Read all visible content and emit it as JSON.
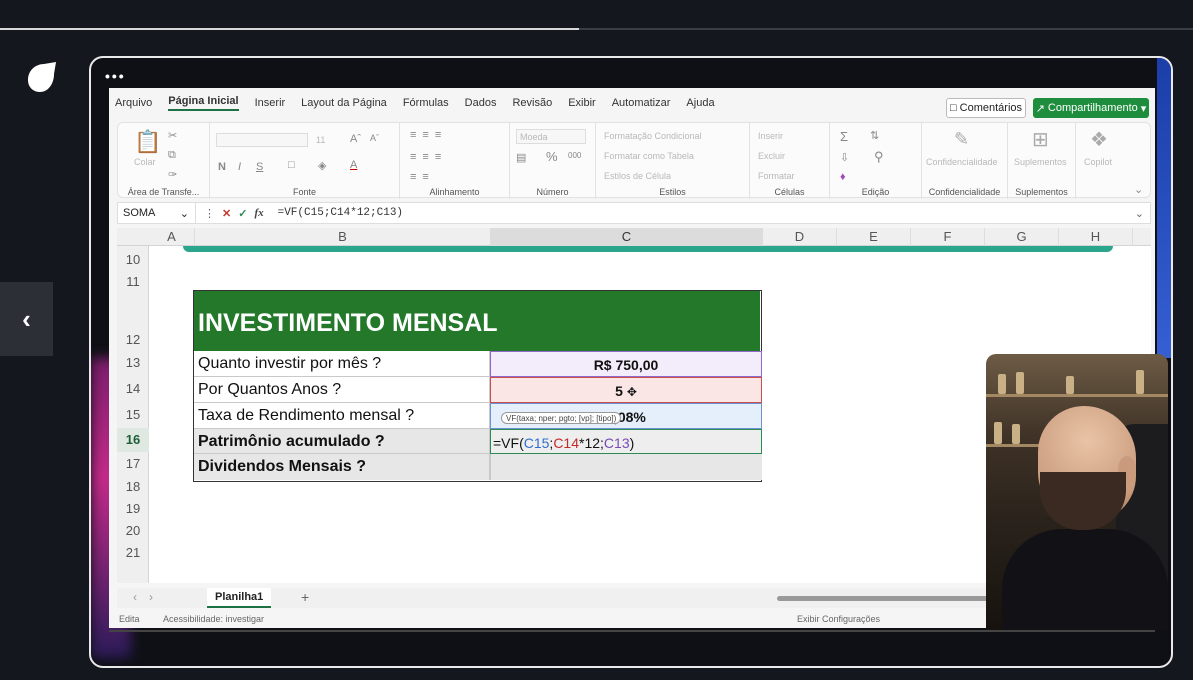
{
  "player": {
    "progress_percent": 48.5
  },
  "excel": {
    "menu": [
      "Arquivo",
      "Página Inicial",
      "Inserir",
      "Layout da Página",
      "Fórmulas",
      "Dados",
      "Revisão",
      "Exibir",
      "Automatizar",
      "Ajuda"
    ],
    "active_menu": "Página Inicial",
    "comments_label": "Comentários",
    "share_label": "Compartilhamento",
    "ribbon_groups": {
      "clipboard": "Área de Transfe...",
      "font": "Fonte",
      "alignment": "Alinhamento",
      "number": "Número",
      "styles": "Estilos",
      "cells": "Células",
      "editing": "Edição",
      "sensitivity": "Confidencialidade",
      "addins": "Suplementos"
    },
    "ribbon_items": {
      "paste": "Colar",
      "number_format": "Moeda",
      "cond_format": "Formatação Condicional",
      "format_table": "Formatar como Tabela",
      "cell_styles": "Estilos de Célula",
      "insert": "Inserir",
      "delete": "Excluir",
      "format": "Formatar",
      "sensitivity": "Confidencialidade",
      "addins": "Suplementos",
      "copilot": "Copilot",
      "font_size": "11",
      "bold": "N",
      "italic": "I",
      "underline": "S"
    },
    "name_box": "SOMA",
    "formula": "=VF(C15;C14*12;C13)",
    "columns": [
      "A",
      "B",
      "C",
      "D",
      "E",
      "F",
      "G",
      "H"
    ],
    "rows": [
      "10",
      "11",
      "12",
      "13",
      "14",
      "15",
      "16",
      "17",
      "18",
      "19",
      "20",
      "21"
    ],
    "table": {
      "title": "INVESTIMENTO MENSAL",
      "labels": [
        "Quanto investir por mês ?",
        "Por Quantos Anos ?",
        "Taxa de Rendimento mensal ?",
        "Patrimônio acumulado ?",
        "Dividendos Mensais ?"
      ],
      "values": [
        "R$ 750,00",
        "5",
        "1,08%"
      ],
      "formula_parts": {
        "a": "=VF(",
        "b": "C15",
        "c": ";",
        "d": "C14",
        "e": "*12;",
        "f": "C13",
        "g": ")"
      },
      "tooltip": "VF(taxa; nper; pgto; [vp]; [tipo])"
    },
    "sheet_tab": "Planilha1",
    "status": {
      "mode": "Edita",
      "accessibility": "Acessibilidade: investigar",
      "display_settings": "Exibir Configurações"
    }
  },
  "colors": {
    "title_bg": "#23782a",
    "accent": "#1e8e3e",
    "blue_ref": "#2f6fcf",
    "red_ref": "#c42a2a",
    "purple_ref": "#7a49b8"
  }
}
